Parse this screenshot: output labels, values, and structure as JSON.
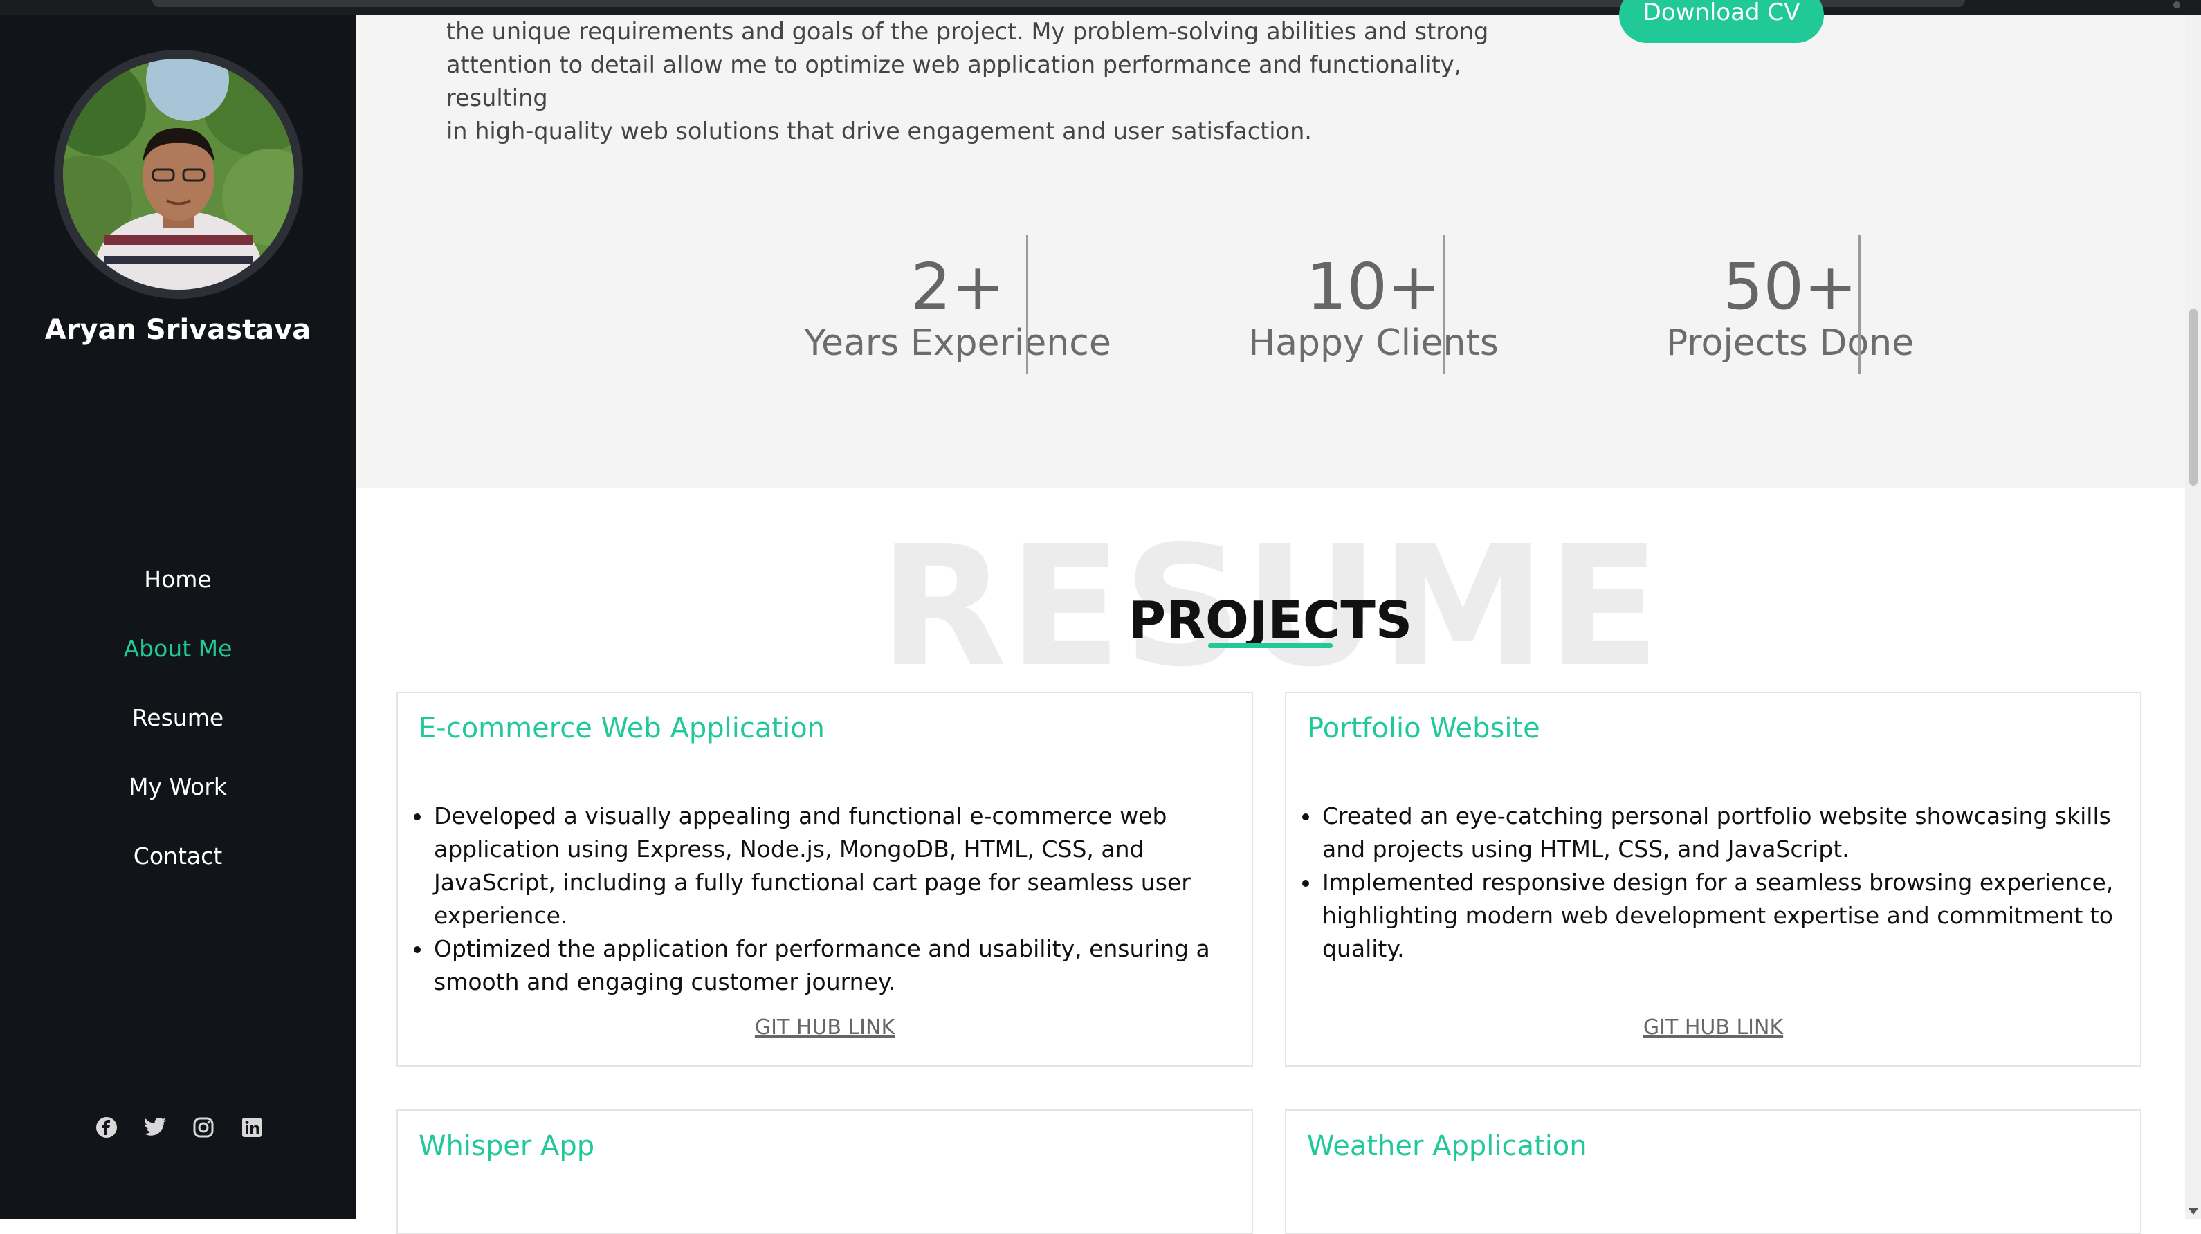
{
  "sidebar": {
    "name": "Aryan Srivastava",
    "nav": [
      "Home",
      "About Me",
      "Resume",
      "My Work",
      "Contact"
    ],
    "active_nav": "About Me",
    "social_icons": [
      "facebook-icon",
      "twitter-icon",
      "instagram-icon",
      "linkedin-icon"
    ]
  },
  "about": {
    "lines": [
      "the unique requirements and goals of the project. My problem-solving abilities and strong",
      "attention to detail allow me to optimize web application performance and functionality, resulting",
      "in high-quality web solutions that drive engagement and user satisfaction."
    ],
    "download_button": "Download CV"
  },
  "stats": [
    {
      "value": "2+",
      "label": "Years Experience"
    },
    {
      "value": "10+",
      "label": "Happy Clients"
    },
    {
      "value": "50+",
      "label": "Projects Done"
    }
  ],
  "section": {
    "background_word": "RESUME",
    "title": "PROJECTS"
  },
  "projects": [
    {
      "title": "E-commerce Web Application",
      "bullets": [
        "Developed a visually appealing and functional e-commerce web application using Express, Node.js, MongoDB, HTML, CSS, and JavaScript, including a fully functional cart page for seamless user experience.",
        "Optimized the application for performance and usability, ensuring a smooth and engaging customer journey."
      ],
      "link": "GIT HUB LINK"
    },
    {
      "title": "Portfolio Website",
      "bullets": [
        "Created an eye-catching personal portfolio website showcasing skills and projects using HTML, CSS, and JavaScript.",
        "Implemented responsive design for a seamless browsing experience, highlighting modern web development expertise and commitment to quality."
      ],
      "link": "GIT HUB LINK"
    },
    {
      "title": "Whisper App"
    },
    {
      "title": "Weather Application"
    }
  ],
  "colors": {
    "accent": "#20c997",
    "sidebar_bg": "#111418",
    "about_bg": "#f4f4f4"
  }
}
